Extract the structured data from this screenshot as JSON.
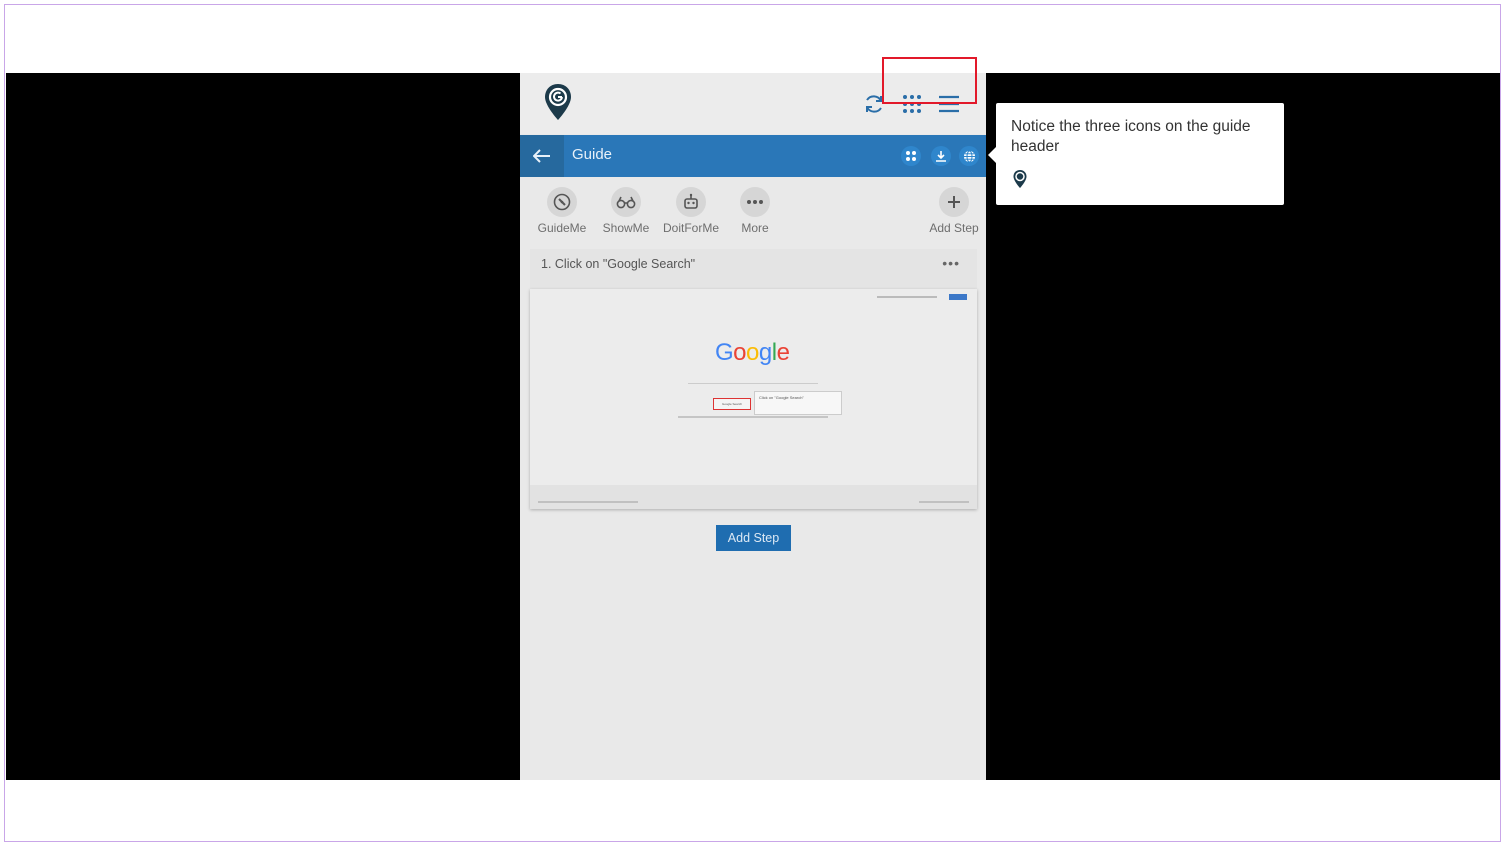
{
  "guide_header": {
    "title": "Guide"
  },
  "actions": [
    {
      "label": "GuideMe",
      "icon": "compass-icon"
    },
    {
      "label": "ShowMe",
      "icon": "binoculars-icon"
    },
    {
      "label": "DoitForMe",
      "icon": "robot-icon"
    },
    {
      "label": "More",
      "icon": "more-horizontal-icon"
    },
    {
      "label": "Add Step",
      "icon": "plus-icon"
    }
  ],
  "step": {
    "title": "1. Click on \"Google Search\"",
    "more": "•••",
    "screenshot": {
      "logo_letters": [
        "G",
        "o",
        "o",
        "g",
        "l",
        "e"
      ],
      "logo_colors": [
        "#4285f4",
        "#ea4335",
        "#fbbc05",
        "#4285f4",
        "#34a853",
        "#ea4335"
      ],
      "callout": "Click on \"Google Search\"",
      "button": "Google Search"
    }
  },
  "add_step_button": "Add Step",
  "tooltip": {
    "text": "Notice the three icons on the guide header",
    "icon": "guide-pin-icon"
  },
  "colors": {
    "header_blue": "#2a77b8",
    "highlight_red": "#e2192a",
    "brand_dark": "#1c3a4a"
  }
}
